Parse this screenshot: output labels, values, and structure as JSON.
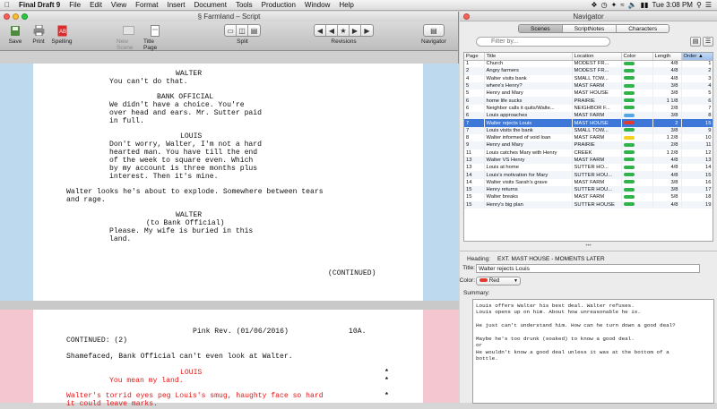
{
  "menubar": {
    "app": "Final Draft 9",
    "items": [
      "File",
      "Edit",
      "View",
      "Format",
      "Insert",
      "Document",
      "Tools",
      "Production",
      "Window",
      "Help"
    ],
    "clock": "Tue 3:08 PM"
  },
  "main_window": {
    "title": "Farmland – Script",
    "toolbar": {
      "save": "Save",
      "print": "Print",
      "spelling": "Spelling",
      "new_scene": "New Scene",
      "title_page": "Title Page",
      "split": "Split",
      "revisions": "Revisions",
      "navigator": "Navigator"
    }
  },
  "script": {
    "page1": [
      "WALTER",
      "You can't do that.",
      "BANK OFFICIAL",
      "We didn't have a choice. You're",
      "over head and ears. Mr. Sutter paid",
      "in full.",
      "LOUIS",
      "Don't worry, Walter, I'm not a hard",
      "hearted man. You have till the end",
      "of the week to square even. Which",
      "by my account is three months plus",
      "interest. Then it's mine.",
      "Walter looks he's about to explode. Somewhere between tears",
      "and rage.",
      "WALTER",
      "(to Bank Official)",
      "Please. My wife is buried in this",
      "land.",
      "(CONTINUED)"
    ],
    "page2": {
      "header": "Pink Rev. (01/06/2016)",
      "page_no": "10A.",
      "continued": "CONTINUED: (2)",
      "action": "Shamefaced, Bank Official can't even look at Walter.",
      "char": "LOUIS",
      "dialogue": "You mean my land.",
      "red_action_1": "Walter's torrid eyes peg Louis's smug, haughty face so hard",
      "red_action_2": "it could leave marks."
    }
  },
  "navigator": {
    "title": "Navigator",
    "tabs": [
      "Scenes",
      "ScriptNotes",
      "Characters"
    ],
    "active_tab": "Scenes",
    "filter_placeholder": "Filter by...",
    "columns": [
      "Page",
      "Title",
      "Location",
      "Color",
      "Length",
      "Order"
    ],
    "scenes": [
      {
        "page": "1",
        "title": "Church",
        "location": "MODEST FR...",
        "color": "#2fb34a",
        "length": "4/8",
        "order": "1"
      },
      {
        "page": "2",
        "title": "Angry farmers",
        "location": "MODEST FR...",
        "color": "#2fb34a",
        "length": "4/8",
        "order": "2"
      },
      {
        "page": "4",
        "title": "Walter visits bank",
        "location": "SMALL TOW...",
        "color": "#2fb34a",
        "length": "4/8",
        "order": "3"
      },
      {
        "page": "5",
        "title": "where's Henry?",
        "location": "MAST FARM",
        "color": "#2fb34a",
        "length": "3/8",
        "order": "4"
      },
      {
        "page": "5",
        "title": "Henry and Mary",
        "location": "MAST HOUSE",
        "color": "#2fb34a",
        "length": "3/8",
        "order": "5"
      },
      {
        "page": "6",
        "title": "home life sucks",
        "location": "PRAIRIE",
        "color": "#2fb34a",
        "length": "1 1/8",
        "order": "6"
      },
      {
        "page": "6",
        "title": "Neighbor calls it quits/Walte...",
        "location": "NEIGHBOR F...",
        "color": "#2fb34a",
        "length": "2/8",
        "order": "7"
      },
      {
        "page": "6",
        "title": "Louis approaches",
        "location": "MAST FARM",
        "color": "#55a6e6",
        "length": "3/8",
        "order": "8"
      },
      {
        "page": "7",
        "title": "Walter rejects Louis",
        "location": "MAST HOUSE",
        "color": "#e23b2e",
        "length": "2",
        "order": "15"
      },
      {
        "page": "7",
        "title": "Louis visits the bank",
        "location": "SMALL TOW...",
        "color": "#2fb34a",
        "length": "3/8",
        "order": "9"
      },
      {
        "page": "8",
        "title": "Walter informed of void loan",
        "location": "MAST FARM",
        "color": "#f2d21c",
        "length": "1 2/8",
        "order": "10"
      },
      {
        "page": "9",
        "title": "Henry and Mary",
        "location": "PRAIRIE",
        "color": "#2fb34a",
        "length": "2/8",
        "order": "11"
      },
      {
        "page": "11",
        "title": "Louis catches Mary with Henry",
        "location": "CREEK",
        "color": "#2fb34a",
        "length": "1 2/8",
        "order": "12"
      },
      {
        "page": "13",
        "title": "Walter VS Henry",
        "location": "MAST FARM",
        "color": "#2fb34a",
        "length": "4/8",
        "order": "13"
      },
      {
        "page": "13",
        "title": "Louis at home",
        "location": "SUTTER HO...",
        "color": "#2fb34a",
        "length": "4/8",
        "order": "14"
      },
      {
        "page": "14",
        "title": "Louis's motivation for Mary",
        "location": "SUTTER HOU...",
        "color": "#2fb34a",
        "length": "4/8",
        "order": "15"
      },
      {
        "page": "14",
        "title": "Walter visits Sarah's grave",
        "location": "MAST FARM",
        "color": "#2fb34a",
        "length": "3/8",
        "order": "16"
      },
      {
        "page": "15",
        "title": "Henry returns",
        "location": "SUTTER HOU...",
        "color": "#2fb34a",
        "length": "3/8",
        "order": "17"
      },
      {
        "page": "15",
        "title": "Walter breaks",
        "location": "MAST FARM",
        "color": "#2fb34a",
        "length": "5/8",
        "order": "18"
      },
      {
        "page": "15",
        "title": "Henry's big plan",
        "location": "SUTTER HOUSE",
        "color": "#2fb34a",
        "length": "4/8",
        "order": "19"
      }
    ],
    "selected_index": 8,
    "heading_label": "Heading:",
    "heading_value": "EXT. MAST HOUSE - MOMENTS LATER",
    "title_label": "Title:",
    "title_value": "Walter rejects Louis",
    "color_label": "Color:",
    "color_value": "Red",
    "summary_label": "Summary:",
    "summary": [
      "Louis offers Walter his best deal. Walter refuses.",
      "Louis opens up on him. About how unreasonable he is.",
      "",
      "He just can't understand him. How can he turn down a good deal?",
      "",
      "Maybe he's too drunk (soaked) to know a good deal.",
      "or",
      "He wouldn't know a good deal unless it was at the bottom of a",
      "bottle."
    ]
  }
}
